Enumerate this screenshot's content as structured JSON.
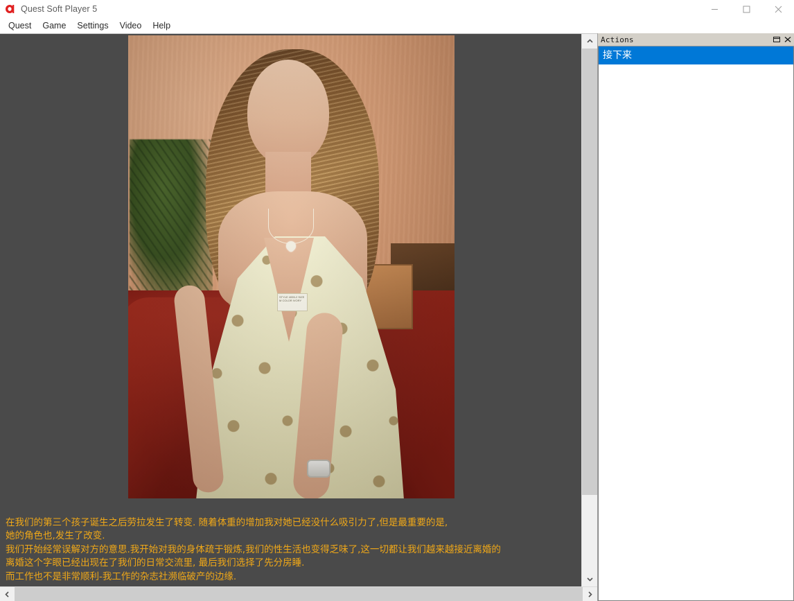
{
  "window": {
    "title": "Quest Soft Player 5",
    "icon": "quest-logo-icon",
    "controls": {
      "minimize": "minimize-icon",
      "maximize": "maximize-icon",
      "close": "close-icon"
    }
  },
  "menubar": {
    "items": [
      {
        "label": "Quest"
      },
      {
        "label": "Game"
      },
      {
        "label": "Settings"
      },
      {
        "label": "Video"
      },
      {
        "label": "Help"
      }
    ]
  },
  "main": {
    "story_lines": [
      "在我们的第三个孩子诞生之后劳拉发生了转变. 随着体重的增加我对她已经没什么吸引力了,但是最重要的是,",
      "她的角色也,发生了改变.",
      "我们开始经常误解对方的意思.我开始对我的身体疏于锻炼,我们的性生活也变得乏味了,这一切都让我们越来越接近离婚的",
      "离婚这个字眼已经出现在了我们的日常交流里, 最后我们选择了先分房睡.",
      "而工作也不是非常顺利-我工作的杂志社濒临破产的边缘."
    ],
    "image_alt": "portrait-photo",
    "image_tag_text": "STYLE 4055-2 SIZE M COLOR IVORY"
  },
  "scrollbars": {
    "vertical": {
      "up": "scroll-up-icon",
      "down": "scroll-down-icon"
    },
    "horizontal": {
      "left": "scroll-left-icon",
      "right": "scroll-right-icon"
    }
  },
  "actions": {
    "title": "Actions",
    "float_button": "restore-window-icon",
    "close_button": "close-panel-icon",
    "items": [
      {
        "label": "接下来",
        "selected": true
      }
    ]
  },
  "colors": {
    "story_text": "#f0a818",
    "stage_background": "#4a4a4a",
    "selection": "#0078d7",
    "panel_header": "#d4d0c8",
    "accent_logo": "#e02020"
  }
}
